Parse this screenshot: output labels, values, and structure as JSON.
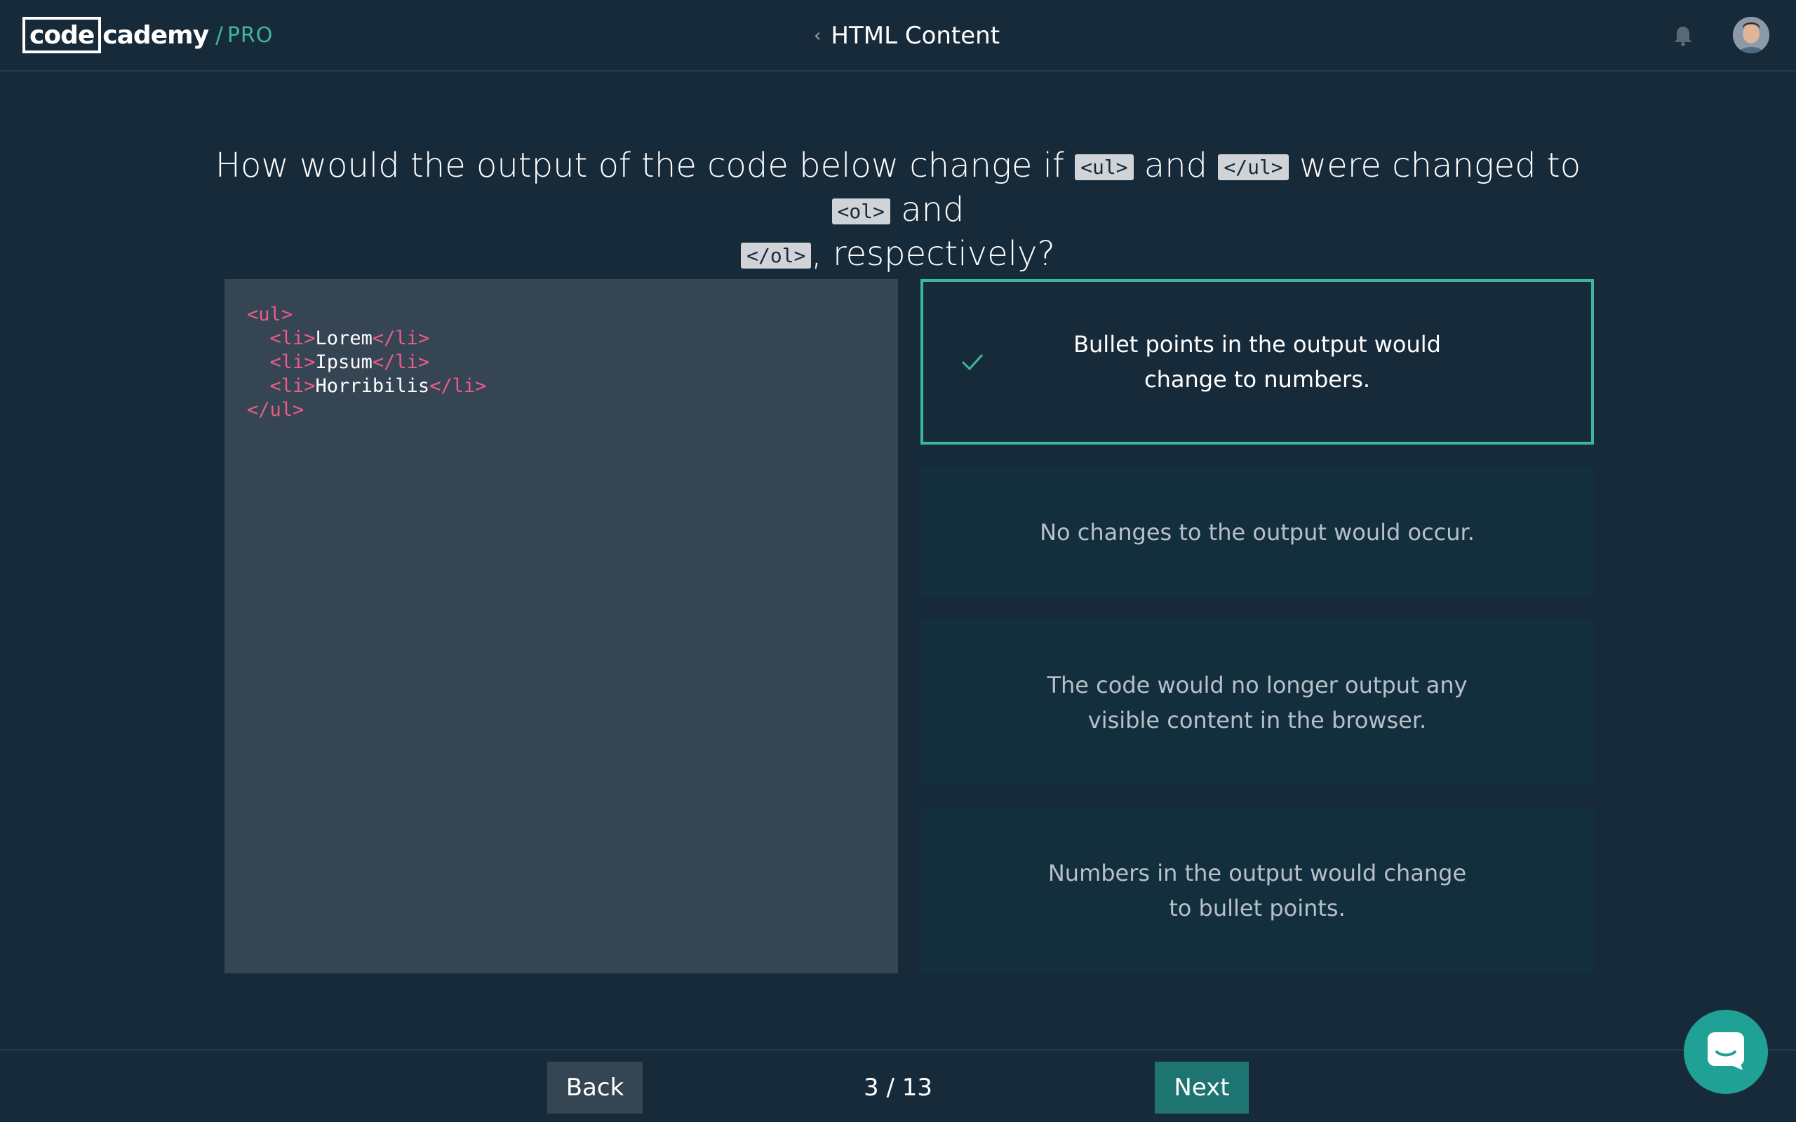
{
  "header": {
    "logo_box": "code",
    "logo_rest": "cademy",
    "logo_slash": "/",
    "logo_pro": "PRO",
    "crumb_title": "HTML Content",
    "crumb_icon": "chevron-left-icon",
    "bell_icon": "bell-icon"
  },
  "question": {
    "part1": "How would the output of the code below change if ",
    "chip1": "<ul>",
    "part2": " and ",
    "chip2": "</ul>",
    "part3": " were changed to ",
    "chip3": "<ol>",
    "part4": " and ",
    "chip4": "</ol>",
    "part5": ", respectively?"
  },
  "code": {
    "l1_tag": "<ul>",
    "l2_indent": "  ",
    "l2_open": "<li>",
    "l2_text": "Lorem",
    "l2_close": "</li>",
    "l3_indent": "  ",
    "l3_open": "<li>",
    "l3_text": "Ipsum",
    "l3_close": "</li>",
    "l4_indent": "  ",
    "l4_open": "<li>",
    "l4_text": "Horribilis",
    "l4_close": "</li>",
    "l5_tag": "</ul>"
  },
  "answers": [
    {
      "text": "Bullet points in the output would change to numbers.",
      "selected": true
    },
    {
      "text": "No changes to the output would occur.",
      "selected": false
    },
    {
      "text": "The code would no longer output any visible content in the browser.",
      "selected": false
    },
    {
      "text": "Numbers in the output would change to bullet points.",
      "selected": false
    }
  ],
  "footer": {
    "back_label": "Back",
    "progress": "3 / 13",
    "next_label": "Next"
  },
  "colors": {
    "background": "#172a3a",
    "accent": "#3bb6a0",
    "code_tag": "#e85d86",
    "next_button": "#1e7470"
  }
}
